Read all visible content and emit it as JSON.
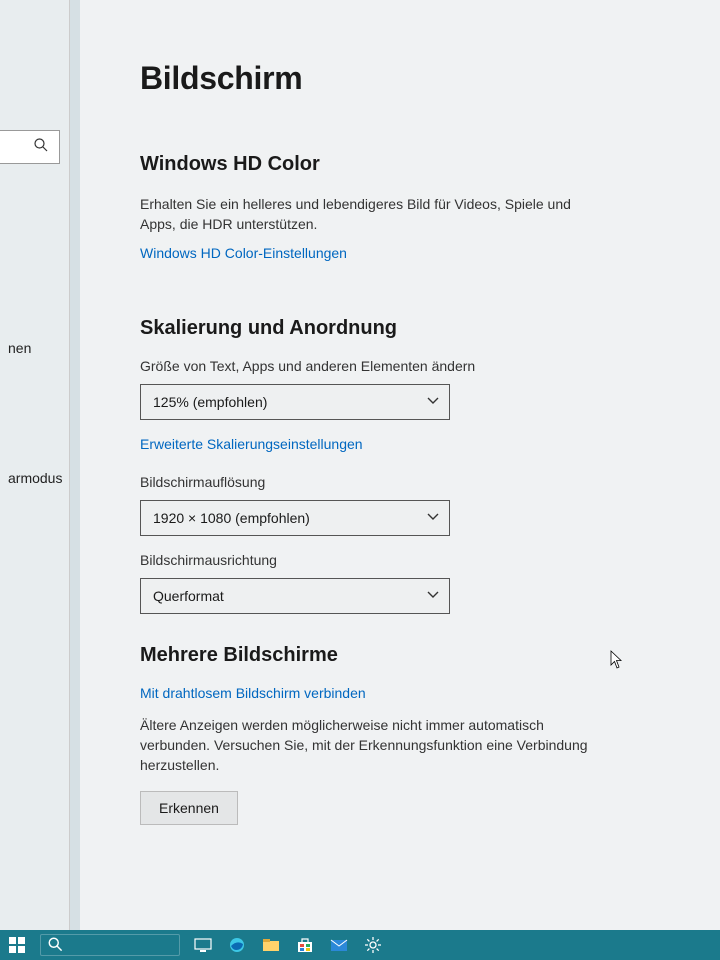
{
  "sidebar": {
    "nav1": "nen",
    "nav2": "armodus"
  },
  "page": {
    "title": "Bildschirm"
  },
  "hdcolor": {
    "heading": "Windows HD Color",
    "desc": "Erhalten Sie ein helleres und lebendigeres Bild für Videos, Spiele und Apps, die HDR unterstützen.",
    "link": "Windows HD Color-Einstellungen"
  },
  "scaling": {
    "heading": "Skalierung und Anordnung",
    "size_label": "Größe von Text, Apps und anderen Elementen ändern",
    "size_value": "125% (empfohlen)",
    "advanced_link": "Erweiterte Skalierungseinstellungen",
    "res_label": "Bildschirmauflösung",
    "res_value": "1920 × 1080 (empfohlen)",
    "orient_label": "Bildschirmausrichtung",
    "orient_value": "Querformat"
  },
  "multi": {
    "heading": "Mehrere Bildschirme",
    "link": "Mit drahtlosem Bildschirm verbinden",
    "desc": "Ältere Anzeigen werden möglicherweise nicht immer automatisch verbunden. Versuchen Sie, mit der Erkennungsfunktion eine Verbindung herzustellen.",
    "button": "Erkennen"
  }
}
